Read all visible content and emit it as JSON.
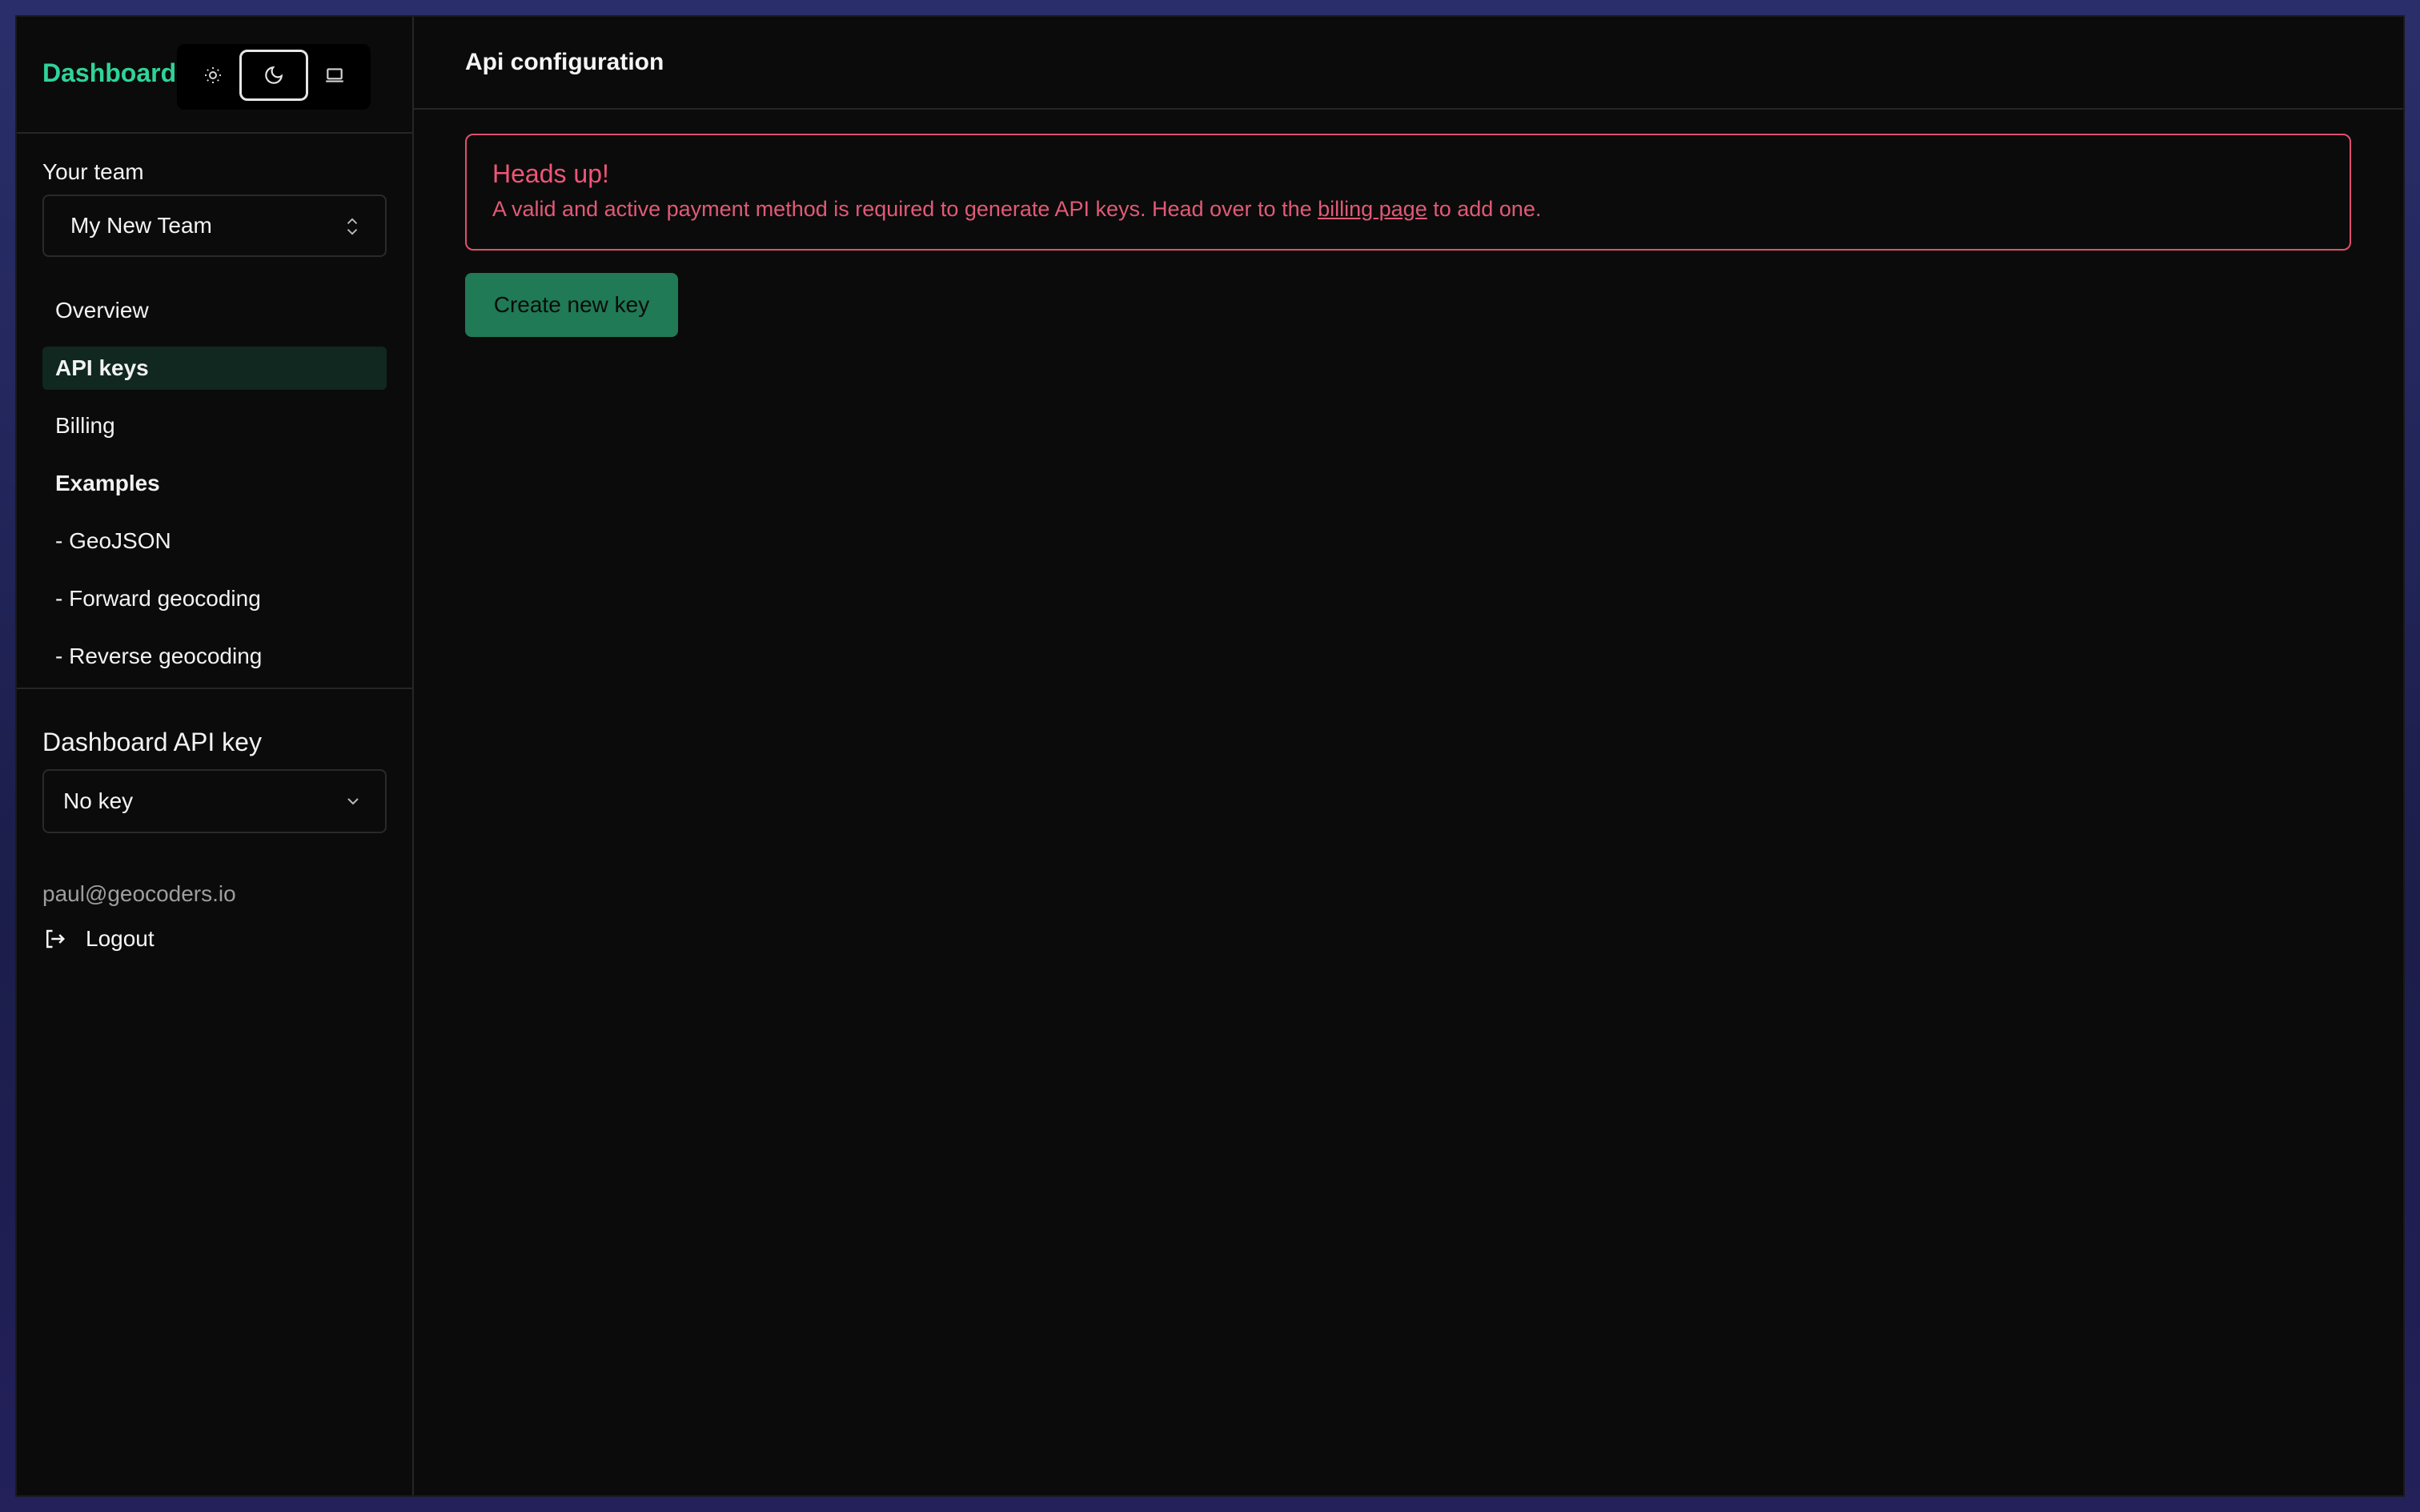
{
  "sidebar": {
    "brand": "Dashboard",
    "theme_switch": {
      "options": [
        {
          "name": "light",
          "icon": "sun-icon"
        },
        {
          "name": "dark",
          "icon": "moon-icon",
          "selected": true
        },
        {
          "name": "system",
          "icon": "laptop-icon"
        }
      ]
    },
    "team_label": "Your team",
    "team_selected": "My New Team",
    "nav": [
      {
        "label": "Overview",
        "active": false
      },
      {
        "label": "API keys",
        "active": true
      },
      {
        "label": "Billing",
        "active": false
      },
      {
        "label": "Examples",
        "heading": true
      },
      {
        "label": "- GeoJSON"
      },
      {
        "label": "- Forward geocoding"
      },
      {
        "label": "- Reverse geocoding"
      }
    ],
    "api_key_label": "Dashboard API key",
    "api_key_selected": "No key",
    "user_email": "paul@geocoders.io",
    "logout_label": "Logout"
  },
  "main": {
    "title": "Api configuration",
    "alert": {
      "title": "Heads up!",
      "body_before": "A valid and active payment method is required to generate API keys. Head over to the ",
      "link": "billing page",
      "body_after": " to add one."
    },
    "create_button": "Create new key"
  },
  "colors": {
    "accent": "#2fd39a",
    "alert": "#e0506e",
    "primary_button": "#1f7a55",
    "active_nav": "#10281f"
  }
}
